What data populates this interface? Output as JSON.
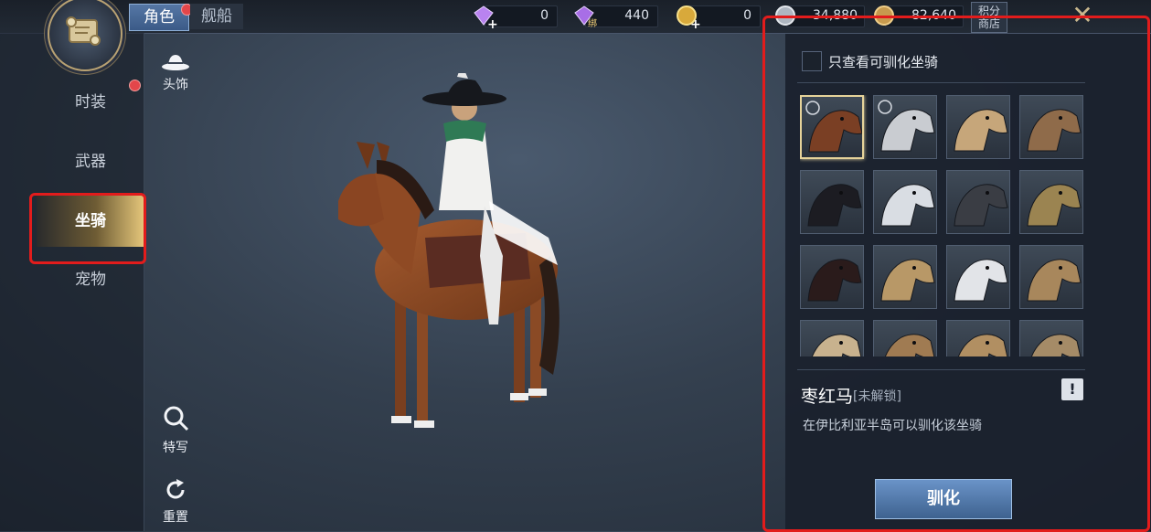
{
  "header": {
    "tabs": [
      {
        "label": "角色",
        "active": true,
        "badge": true
      },
      {
        "label": "舰船",
        "active": false,
        "badge": false
      }
    ],
    "currencies": [
      {
        "icon": "diamond-icon",
        "value": "0"
      },
      {
        "icon": "bound-diamond-icon",
        "tag": "绑",
        "value": "440"
      },
      {
        "icon": "gold-coin-icon",
        "value": "0"
      },
      {
        "icon": "silver-coin-icon",
        "value": "34,880"
      },
      {
        "icon": "copper-coin-icon",
        "value": "82,640"
      }
    ],
    "shop_label_line1": "积分",
    "shop_label_line2": "商店",
    "close_symbol": "✕"
  },
  "sidebar": {
    "items": [
      {
        "label": "时装",
        "badge": true
      },
      {
        "label": "武器",
        "badge": false
      },
      {
        "label": "坐骑",
        "active": true
      },
      {
        "label": "宠物",
        "badge": false
      }
    ]
  },
  "viewer": {
    "headwear_label": "头饰",
    "closeup_label": "特写",
    "reset_label": "重置"
  },
  "panel": {
    "filter_label": "只查看可驯化坐骑",
    "filter_checked": false,
    "mounts": [
      {
        "icon": "chestnut-horse-icon",
        "selected": true,
        "color": "#7a3f24",
        "locked": true
      },
      {
        "icon": "grey-horse-icon",
        "color": "#c9ccd1",
        "locked": true
      },
      {
        "icon": "camel-icon",
        "color": "#c6a67a"
      },
      {
        "icon": "brown-camel-icon",
        "color": "#8f6b4a"
      },
      {
        "icon": "black-horse-icon",
        "color": "#1c1c22"
      },
      {
        "icon": "white-horse-icon",
        "color": "#d9dde3"
      },
      {
        "icon": "armored-horse-icon",
        "color": "#3a3d44"
      },
      {
        "icon": "gold-armored-horse-icon",
        "color": "#9b8451"
      },
      {
        "icon": "red-black-horse-icon",
        "color": "#2a1b1b"
      },
      {
        "icon": "stag-icon",
        "color": "#b89867"
      },
      {
        "icon": "white-stag-icon",
        "color": "#e2e4e8"
      },
      {
        "icon": "tan-camel-icon",
        "color": "#a8875c"
      },
      {
        "icon": "pale-camel-icon",
        "color": "#c8b28e"
      },
      {
        "icon": "deer-icon",
        "color": "#a07b52"
      },
      {
        "icon": "stag-icon",
        "color": "#b18f62"
      },
      {
        "icon": "armored-camel-icon",
        "color": "#a58b67"
      }
    ],
    "selected_name": "枣红马",
    "selected_status": "[未解锁]",
    "info_symbol": "!",
    "description": "在伊比利亚半岛可以驯化该坐骑",
    "tame_button": "驯化"
  },
  "colors": {
    "highlight": "#e21c1c",
    "accent_gold": "#e6c77b",
    "button_blue": "#4f77a9"
  }
}
